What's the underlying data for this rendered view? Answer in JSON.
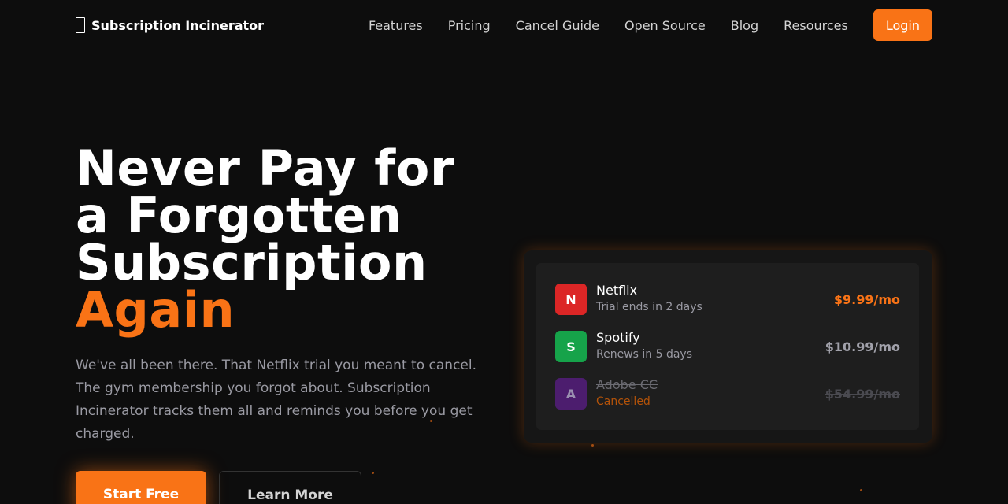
{
  "nav": {
    "brand": "Subscription Incinerator",
    "links": [
      "Features",
      "Pricing",
      "Cancel Guide",
      "Open Source",
      "Blog",
      "Resources"
    ],
    "login": "Login"
  },
  "hero": {
    "title_lines": [
      "Never Pay for",
      "a Forgotten",
      "Subscription"
    ],
    "title_accent": "Again",
    "description": "We've all been there. That Netflix trial you meant to cancel. The gym membership you forgot about. Subscription Incinerator tracks them all and reminds you before you get charged.",
    "primary_cta": "Start Free",
    "secondary_cta": "Learn More"
  },
  "subscriptions": [
    {
      "letter": "N",
      "name": "Netflix",
      "status": "Trial ends in 2 days",
      "price": "$9.99/mo",
      "logo_color": "#dc2626",
      "price_color": "#f97316",
      "cancelled": false
    },
    {
      "letter": "S",
      "name": "Spotify",
      "status": "Renews in 5 days",
      "price": "$10.99/mo",
      "logo_color": "#16a34a",
      "price_color": "#a1a1aa",
      "cancelled": false
    },
    {
      "letter": "A",
      "name": "Adobe CC",
      "status": "Cancelled",
      "price": "$54.99/mo",
      "logo_color": "#4c1d6e",
      "price_color": "#4a4a50",
      "cancelled": true
    }
  ],
  "colors": {
    "accent": "#f97316",
    "background": "#0d0d0d"
  }
}
